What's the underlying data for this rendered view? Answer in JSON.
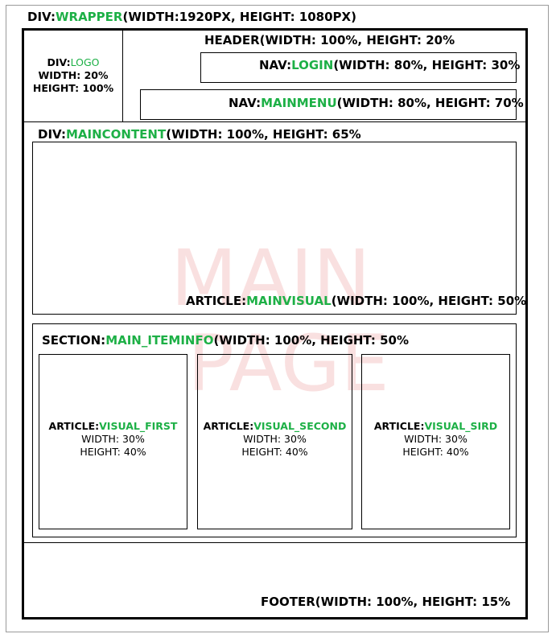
{
  "wrapper": {
    "prefix": "DIV:",
    "name": "WRAPPER",
    "size": "(WIDTH:1920PX,  HEIGHT: 1080PX)"
  },
  "header": {
    "label": "HEADER(WIDTH: 100%, HEIGHT: 20%"
  },
  "logo": {
    "prefix": "DIV:",
    "name": "LOGO",
    "width": "WIDTH: 20%",
    "height": "HEIGHT: 100%"
  },
  "nav_login": {
    "prefix": "NAV:",
    "name": "LOGIN",
    "size": "(WIDTH: 80%, HEIGHT: 30%"
  },
  "nav_mainmenu": {
    "prefix": "NAV:",
    "name": "MAINMENU",
    "size": "(WIDTH: 80%, HEIGHT: 70%"
  },
  "maincontent": {
    "prefix": "DIV:",
    "name": "MAINCONTENT",
    "size": "(WIDTH: 100%, HEIGHT: 65%"
  },
  "mainvisual": {
    "prefix": "ARTICLE:",
    "name": "MAINVISUAL",
    "size": "(WIDTH: 100%, HEIGHT: 50%"
  },
  "watermark": {
    "line1": "MAIN",
    "line2": "PAGE"
  },
  "iteminfo": {
    "prefix": "SECTION:",
    "name": "MAIN_ITEMINFO",
    "size": "(WIDTH: 100%, HEIGHT: 50%"
  },
  "articles": [
    {
      "prefix": "ARTICLE:",
      "name": "VISUAL_FIRST",
      "width": "WIDTH: 30%",
      "height": "HEIGHT: 40%"
    },
    {
      "prefix": "ARTICLE:",
      "name": "VISUAL_SECOND",
      "width": "WIDTH: 30%",
      "height": "HEIGHT: 40%"
    },
    {
      "prefix": "ARTICLE:",
      "name": "VISUAL_SIRD",
      "width": "WIDTH: 30%",
      "height": "HEIGHT: 40%"
    }
  ],
  "footer": {
    "label": "FOOTER(WIDTH: 100%, HEIGHT: 15%"
  },
  "colors": {
    "accent_green": "#1db046",
    "watermark": "#f2d9d9",
    "line": "#000000"
  }
}
